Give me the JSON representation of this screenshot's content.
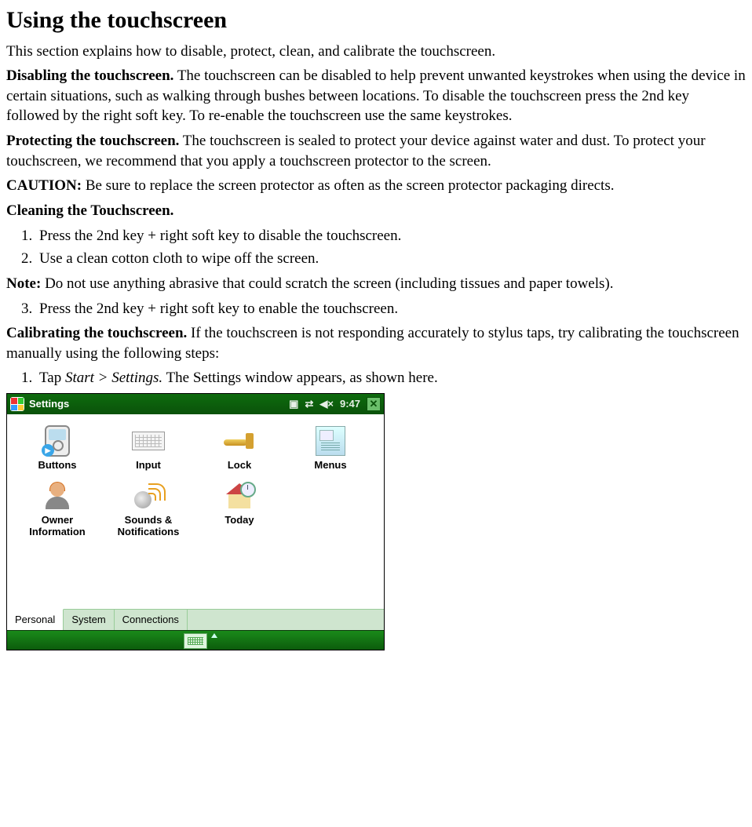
{
  "heading": "Using the touchscreen",
  "intro": "This section explains how to disable, protect, clean, and calibrate the touchscreen.",
  "disabling": {
    "label": "Disabling the touchscreen.",
    "text": " The touchscreen can be disabled to help prevent unwanted keystrokes when using the device in certain situations, such as walking through bushes between locations. To disable the touchscreen press the 2nd key followed by the right soft key. To re-enable the touchscreen use the same keystrokes."
  },
  "protecting": {
    "label": "Protecting the touchscreen.",
    "text": " The touchscreen is sealed to protect your device against water and dust. To protect your touchscreen, we recommend that you apply a touchscreen protector to the screen."
  },
  "caution": {
    "label": "CAUTION:",
    "text": " Be sure to replace the screen protector as often as the screen protector packaging directs."
  },
  "cleaning": {
    "label": "Cleaning the Touchscreen.",
    "steps12": [
      "Press the 2nd key + right soft key to disable the touchscreen.",
      "Use a clean cotton cloth to wipe off the screen."
    ],
    "note_label": "Note:",
    "note_text": " Do not use anything abrasive that could scratch the screen (including tissues and paper towels).",
    "step3": "Press the 2nd key + right soft key to enable the touchscreen."
  },
  "calibrating": {
    "label": "Calibrating the touchscreen.",
    "text": " If the touchscreen is not responding accurately to stylus taps, try calibrating the touchscreen manually using the following steps:",
    "step1_prefix": "Tap ",
    "step1_italic": "Start > Settings.",
    "step1_suffix": " The Settings window appears, as shown here."
  },
  "device": {
    "title": "Settings",
    "time": "9:47",
    "apps": [
      {
        "key": "buttons",
        "label": "Buttons"
      },
      {
        "key": "input",
        "label": "Input"
      },
      {
        "key": "lock",
        "label": "Lock"
      },
      {
        "key": "menus",
        "label": "Menus"
      },
      {
        "key": "owner",
        "label": "Owner\nInformation"
      },
      {
        "key": "sounds",
        "label": "Sounds &\nNotifications"
      },
      {
        "key": "today",
        "label": "Today"
      }
    ],
    "tabs": [
      {
        "key": "personal",
        "label": "Personal",
        "active": true
      },
      {
        "key": "system",
        "label": "System",
        "active": false
      },
      {
        "key": "connections",
        "label": "Connections",
        "active": false
      }
    ]
  }
}
